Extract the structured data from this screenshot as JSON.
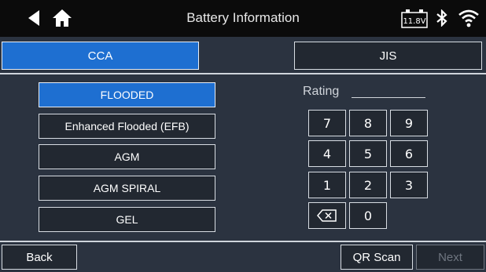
{
  "header": {
    "title": "Battery Information",
    "voltage": "11.8V"
  },
  "tabs": [
    {
      "label": "CCA",
      "selected": true
    },
    {
      "label": "JIS",
      "selected": false
    }
  ],
  "battery_types": [
    {
      "label": "FLOODED",
      "selected": true
    },
    {
      "label": "Enhanced Flooded (EFB)",
      "selected": false
    },
    {
      "label": "AGM",
      "selected": false
    },
    {
      "label": "AGM SPIRAL",
      "selected": false
    },
    {
      "label": "GEL",
      "selected": false
    }
  ],
  "rating": {
    "label": "Rating",
    "value": ""
  },
  "keypad": [
    "7",
    "8",
    "9",
    "4",
    "5",
    "6",
    "1",
    "2",
    "3",
    "0"
  ],
  "footer": {
    "back": "Back",
    "qr_scan": "QR Scan",
    "next": "Next"
  },
  "colors": {
    "selected": "#1e6fd1",
    "background": "#2b3340",
    "header": "#0b0b0b"
  }
}
